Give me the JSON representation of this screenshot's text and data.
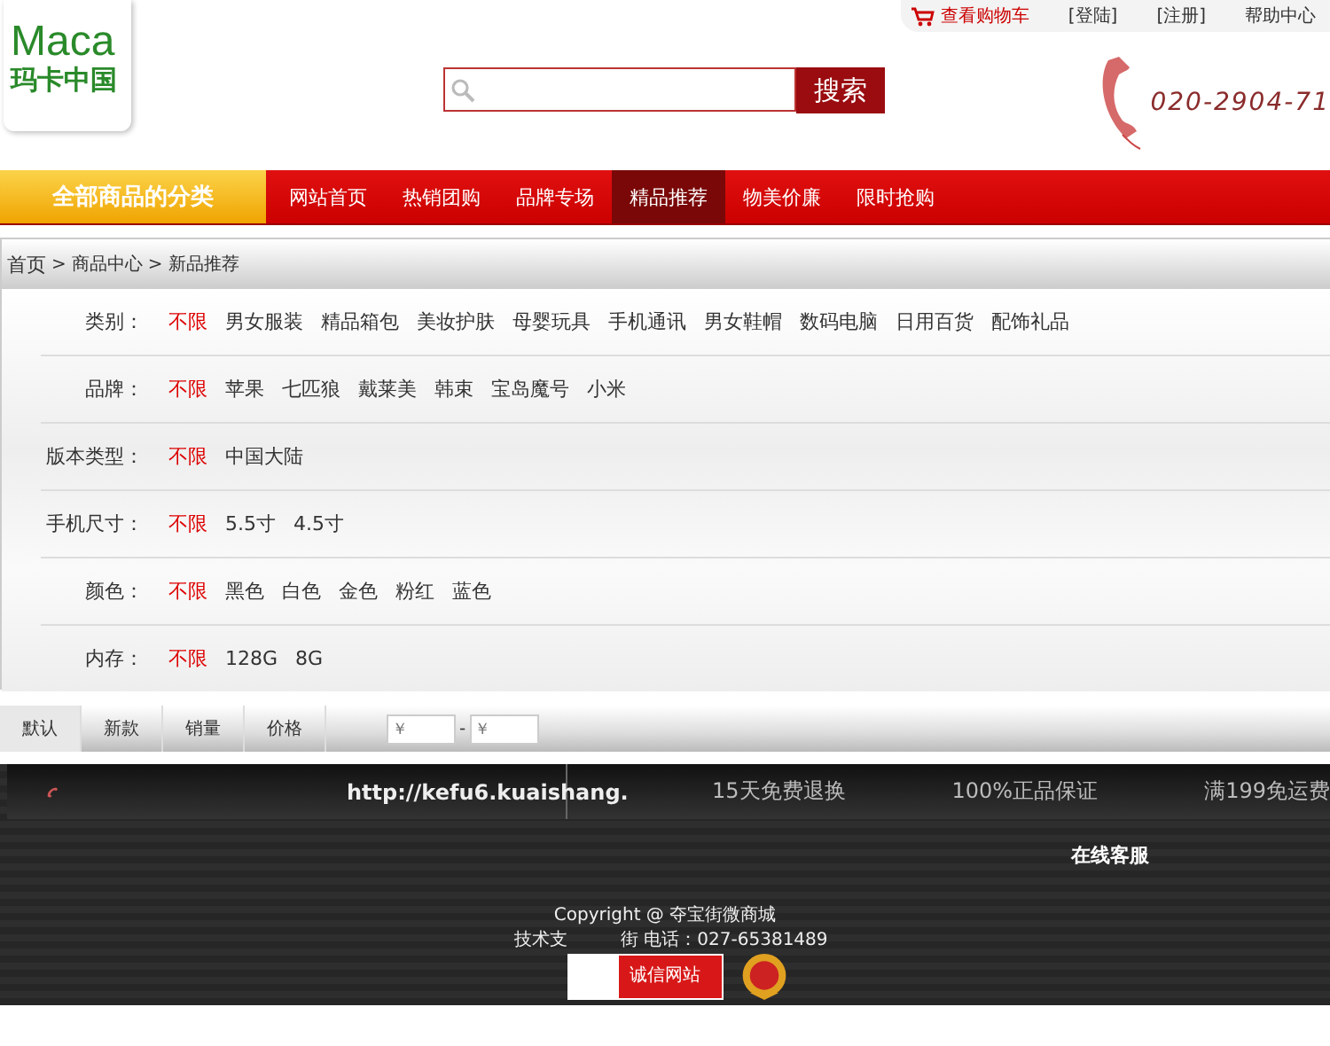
{
  "header": {
    "logo_latin": "Maca",
    "logo_cn": "玛卡中国",
    "search_button": "搜索",
    "top_links": [
      {
        "label": "查看购物车",
        "kind": "cart"
      },
      {
        "label": "[登陆]",
        "kind": "plain"
      },
      {
        "label": "[注册]",
        "kind": "plain"
      },
      {
        "label": "帮助中心",
        "kind": "plain"
      }
    ],
    "hotline": "020-2904-71"
  },
  "nav": {
    "category_button": "全部商品的分类",
    "items": [
      {
        "label": "网站首页",
        "selected": false
      },
      {
        "label": "热销团购",
        "selected": false
      },
      {
        "label": "品牌专场",
        "selected": false
      },
      {
        "label": "精品推荐",
        "selected": true
      },
      {
        "label": "物美价廉",
        "selected": false
      },
      {
        "label": "限时抢购",
        "selected": false
      }
    ]
  },
  "breadcrumb": {
    "separator": ">",
    "items": [
      "首页",
      "商品中心",
      "新品推荐"
    ]
  },
  "filters": [
    {
      "label": "类别：",
      "options": [
        {
          "text": "不限",
          "selected": true
        },
        {
          "text": "男女服装",
          "selected": false
        },
        {
          "text": "精品箱包",
          "selected": false
        },
        {
          "text": "美妆护肤",
          "selected": false
        },
        {
          "text": "母婴玩具",
          "selected": false
        },
        {
          "text": "手机通讯",
          "selected": false
        },
        {
          "text": "男女鞋帽",
          "selected": false
        },
        {
          "text": "数码电脑",
          "selected": false
        },
        {
          "text": "日用百货",
          "selected": false
        },
        {
          "text": "配饰礼品",
          "selected": false
        }
      ]
    },
    {
      "label": "品牌：",
      "options": [
        {
          "text": "不限",
          "selected": true
        },
        {
          "text": "苹果",
          "selected": false
        },
        {
          "text": "七匹狼",
          "selected": false
        },
        {
          "text": "戴莱美",
          "selected": false
        },
        {
          "text": "韩束",
          "selected": false
        },
        {
          "text": "宝岛魔号",
          "selected": false
        },
        {
          "text": "小米",
          "selected": false
        }
      ]
    },
    {
      "label": "版本类型：",
      "options": [
        {
          "text": "不限",
          "selected": true
        },
        {
          "text": "中国大陆",
          "selected": false
        }
      ]
    },
    {
      "label": "手机尺寸：",
      "options": [
        {
          "text": "不限",
          "selected": true
        },
        {
          "text": "5.5寸",
          "selected": false
        },
        {
          "text": "4.5寸",
          "selected": false
        }
      ]
    },
    {
      "label": "颜色：",
      "options": [
        {
          "text": "不限",
          "selected": true
        },
        {
          "text": "黑色",
          "selected": false
        },
        {
          "text": "白色",
          "selected": false
        },
        {
          "text": "金色",
          "selected": false
        },
        {
          "text": "粉红",
          "selected": false
        },
        {
          "text": "蓝色",
          "selected": false
        }
      ]
    },
    {
      "label": "内存：",
      "options": [
        {
          "text": "不限",
          "selected": true
        },
        {
          "text": "128G",
          "selected": false
        },
        {
          "text": "8G",
          "selected": false
        }
      ]
    }
  ],
  "sort": {
    "tabs": [
      {
        "label": "默认",
        "selected": true
      },
      {
        "label": "新款",
        "selected": false
      },
      {
        "label": "销量",
        "selected": false
      },
      {
        "label": "价格",
        "selected": false
      }
    ],
    "price_min_placeholder": "￥",
    "separator": "-",
    "price_max_placeholder": "￥"
  },
  "footer": {
    "url": "http://kefu6.kuaishang.",
    "guarantees": [
      "15天免费退换",
      "100%正品保证",
      "满199免运费"
    ],
    "online_service": "在线客服",
    "copyright": "Copyright @ 夺宝街微商城",
    "support_prefix": "技术支",
    "support_suffix": "街 电话：027-65381489",
    "trust_badge": "诚信网站"
  }
}
